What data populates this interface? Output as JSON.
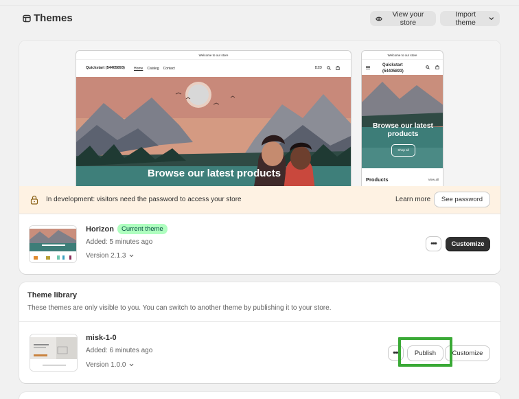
{
  "header": {
    "title": "Themes",
    "view_store": "View your store",
    "import_theme": "Import theme"
  },
  "preview": {
    "desktop": {
      "announcement": "Welcome to our store",
      "brand": "Quickstart (54405893)",
      "nav": [
        "Home",
        "Catalog",
        "Contact"
      ],
      "currency": "DZD",
      "hero_title": "Browse our latest products"
    },
    "mobile": {
      "announcement": "Welcome to our store",
      "brand": "Quickstart (54405893)",
      "hero_title": "Browse our latest products",
      "hero_button": "Shop all",
      "section_title": "Products",
      "view_all": "View all"
    }
  },
  "banner": {
    "text": "In development: visitors need the password to access your store",
    "learn_more": "Learn more",
    "see_password": "See password"
  },
  "current_theme": {
    "name": "Horizon",
    "badge": "Current theme",
    "added": "Added: 5 minutes ago",
    "version": "Version 2.1.3",
    "customize": "Customize"
  },
  "library": {
    "title": "Theme library",
    "description": "These themes are only visible to you. You can switch to another theme by publishing it to your store.",
    "themes": [
      {
        "name": "misk-1-0",
        "added": "Added: 6 minutes ago",
        "version": "Version 1.0.0",
        "publish": "Publish",
        "customize": "Customize"
      }
    ]
  },
  "colors": {
    "primary_button": "#303030",
    "badge_bg": "#affebf",
    "banner_bg": "#fef2e3",
    "highlight": "#3aa936"
  }
}
